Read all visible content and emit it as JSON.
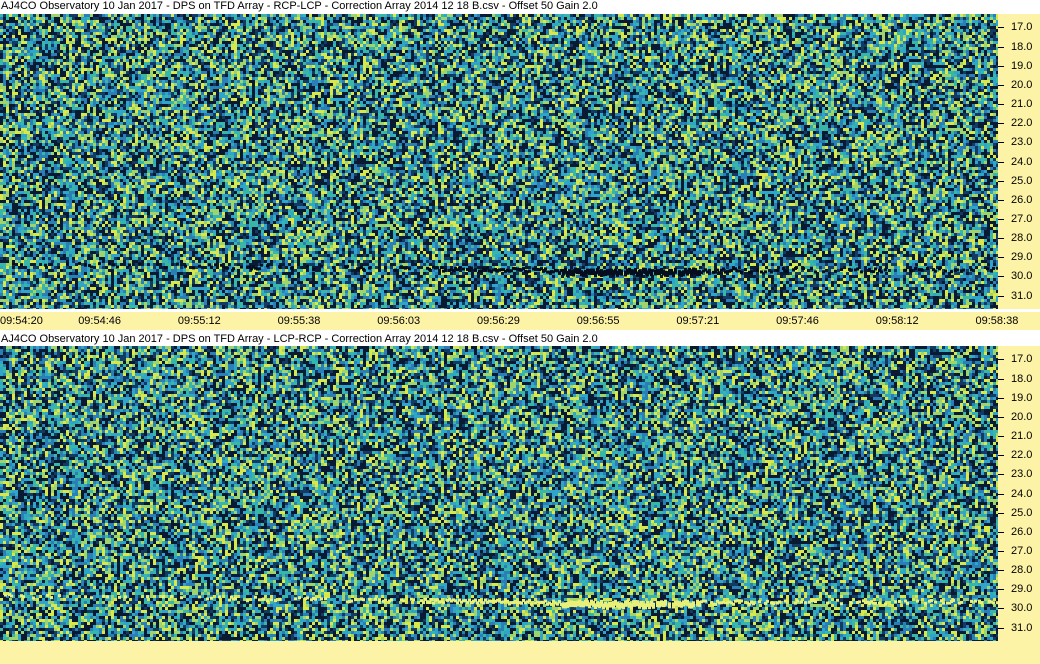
{
  "panels": [
    {
      "title": "AJ4CO Observatory 10 Jan 2017  -  DPS on TFD Array  -  RCP-LCP  -  Correction Array 2014 12 18 B.csv  -  Offset 50  Gain 2.0",
      "y_ticks": [
        "31.0",
        "30.0",
        "29.0",
        "28.0",
        "27.0",
        "26.0",
        "25.0",
        "24.0",
        "23.0",
        "22.0",
        "21.0",
        "20.0",
        "19.0",
        "18.0",
        "17.0"
      ],
      "feature": "dark"
    },
    {
      "title": "AJ4CO Observatory 10 Jan 2017  -  DPS on TFD Array  -  LCP-RCP  -  Correction Array 2014 12 18 B.csv  -  Offset 50  Gain 2.0",
      "y_ticks": [
        "31.0",
        "30.0",
        "29.0",
        "28.0",
        "27.0",
        "26.0",
        "25.0",
        "24.0",
        "23.0",
        "22.0",
        "21.0",
        "20.0",
        "19.0",
        "18.0",
        "17.0"
      ],
      "feature": "bright"
    }
  ],
  "x_ticks": [
    "09:54:20",
    "09:54:46",
    "09:55:12",
    "09:55:38",
    "09:56:03",
    "09:56:29",
    "09:56:55",
    "09:57:21",
    "09:57:46",
    "09:58:12",
    "09:58:38"
  ],
  "colors": {
    "background": "#1b4a6a",
    "axis_bg": "#fdf3a6",
    "noise_dark": "#0a1a33",
    "noise_bright": "#d8e84a"
  },
  "chart_data": {
    "type": "heatmap",
    "xlabel": "",
    "ylabel": "",
    "x_ticks": [
      "09:54:20",
      "09:54:46",
      "09:55:12",
      "09:55:38",
      "09:56:03",
      "09:56:29",
      "09:56:55",
      "09:57:21",
      "09:57:46",
      "09:58:12",
      "09:58:38"
    ],
    "ylim": [
      16.3,
      31.7
    ],
    "y_ticks": [
      17,
      18,
      19,
      20,
      21,
      22,
      23,
      24,
      25,
      26,
      27,
      28,
      29,
      30,
      31
    ]
  }
}
